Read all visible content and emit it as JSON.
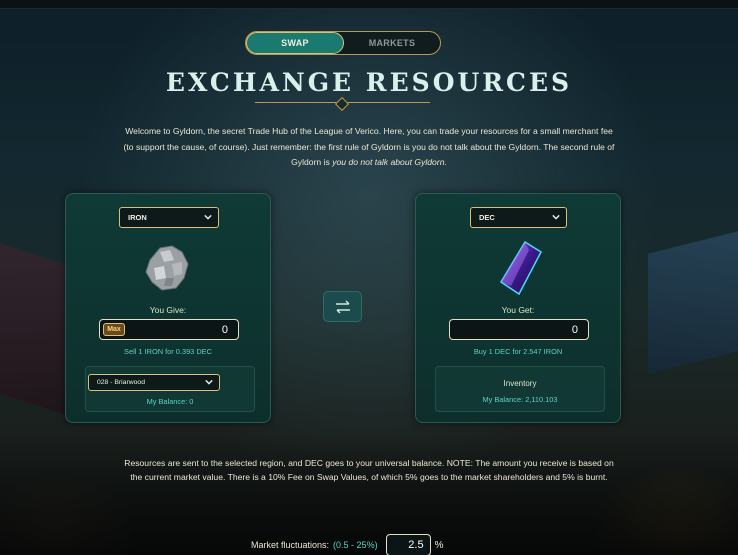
{
  "tabs": [
    {
      "label": "SWAP",
      "active": true
    },
    {
      "label": "MARKETS",
      "active": false
    }
  ],
  "title": "EXCHANGE RESOURCES",
  "intro": {
    "text": "Welcome to Gyldorn, the secret Trade Hub of the League of Verico. Here, you can trade your resources for a small merchant fee (to support the cause, of course). Just remember: the first rule of Gyldorn is you do not talk about the Gyldorn. The second rule of Gyldorn is ",
    "emphasis": "you do not talk about Gyldorn."
  },
  "give": {
    "resource": "IRON",
    "icon": "iron-ore-icon",
    "label": "You Give:",
    "max_label": "Max",
    "amount": "0",
    "rate": "Sell 1 IRON for 0.393 DEC",
    "region": "028 - Briarwood",
    "balance": "My Balance: 0"
  },
  "get": {
    "resource": "DEC",
    "icon": "dec-crystal-icon",
    "label": "You Get:",
    "amount": "0",
    "rate": "Buy 1 DEC for 2.547 IRON",
    "inventory_label": "Inventory",
    "balance": "My Balance: 2,110.103"
  },
  "note": "Resources are sent to the selected region, and DEC goes to your universal balance. NOTE: The amount you receive is based on the current market value. There is a 10% Fee on Swap Values, of which 5% goes to the market shareholders and 5% is burnt.",
  "fluctuations": {
    "label": "Market fluctuations:",
    "range": "(0.5 - 25%)",
    "value": "2.5",
    "unit": "%"
  },
  "colors": {
    "accent": "#1a7a70",
    "gold": "#d8c27a",
    "teal_text": "#59d4c2"
  }
}
